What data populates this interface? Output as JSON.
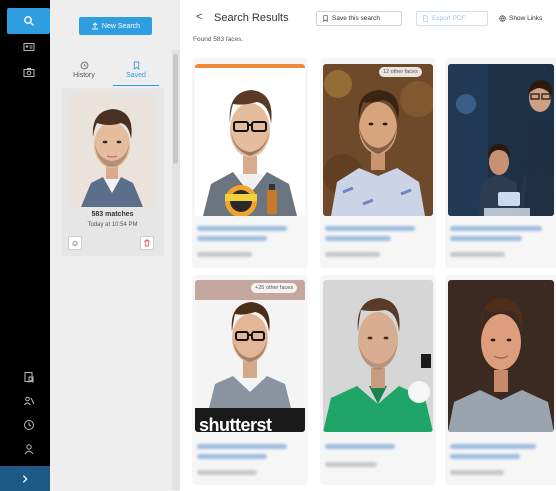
{
  "sidebar": {
    "icons": [
      "search-icon",
      "id-card-icon",
      "camera-icon",
      "bookmark-doc-icon",
      "people-icon",
      "clock-icon",
      "user-icon",
      "chevron-right-icon"
    ],
    "accent_color": "#2f9ee0"
  },
  "panel": {
    "new_search_label": "New Search",
    "tabs": [
      {
        "label": "History",
        "icon": "clock-icon"
      },
      {
        "label": "Saved",
        "icon": "bookmark-icon"
      }
    ],
    "saved_card": {
      "title": "583 matches",
      "date": "Today at 10:54 PM"
    }
  },
  "header": {
    "back_glyph": "<",
    "title": "Search Results",
    "save_label": "Save this search",
    "export_label": "Export PDF",
    "links_label": "Show Links",
    "found_text": "Found 583 faces."
  },
  "results": [
    {
      "badge": "",
      "extra_text": ""
    },
    {
      "badge": "12 other faces",
      "extra_text": ""
    },
    {
      "badge": "",
      "extra_text": ""
    },
    {
      "badge": "+25 other faces",
      "extra_text": "shutterst"
    },
    {
      "badge": "",
      "extra_text": ""
    },
    {
      "badge": "",
      "extra_text": ""
    }
  ]
}
